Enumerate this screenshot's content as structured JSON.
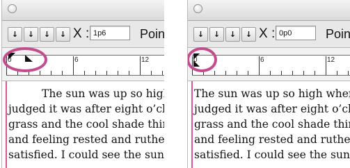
{
  "panels": [
    {
      "x_field_label": "X :",
      "x_value": "1p6",
      "unit_label": "Point",
      "ruler_numbers": [
        "0",
        "6",
        "12"
      ],
      "tab_buttons": [
        "↓",
        "↓",
        "↓",
        "↓"
      ],
      "text_lines": [
        "The sun was up so high w",
        "judged it was after eight o’clock",
        "grass and the cool shade think",
        "and feeling rested and ruther c",
        "satisfied. I could see the sun ou"
      ]
    },
    {
      "x_field_label": "X :",
      "x_value": "0p0",
      "unit_label": "Point",
      "ruler_numbers": [
        "0",
        "6",
        "12"
      ],
      "tab_buttons": [
        "↓",
        "↓",
        "↓",
        "↓"
      ],
      "text_lines": [
        "The sun was up so high when I",
        "judged it was after eight o’clock",
        "grass and the cool shade think",
        "and feeling rested and ruther c",
        "satisfied. I could see the sun ou"
      ]
    }
  ],
  "colors": {
    "highlight": "#c44b8d",
    "margin_line": "#d9559c"
  }
}
